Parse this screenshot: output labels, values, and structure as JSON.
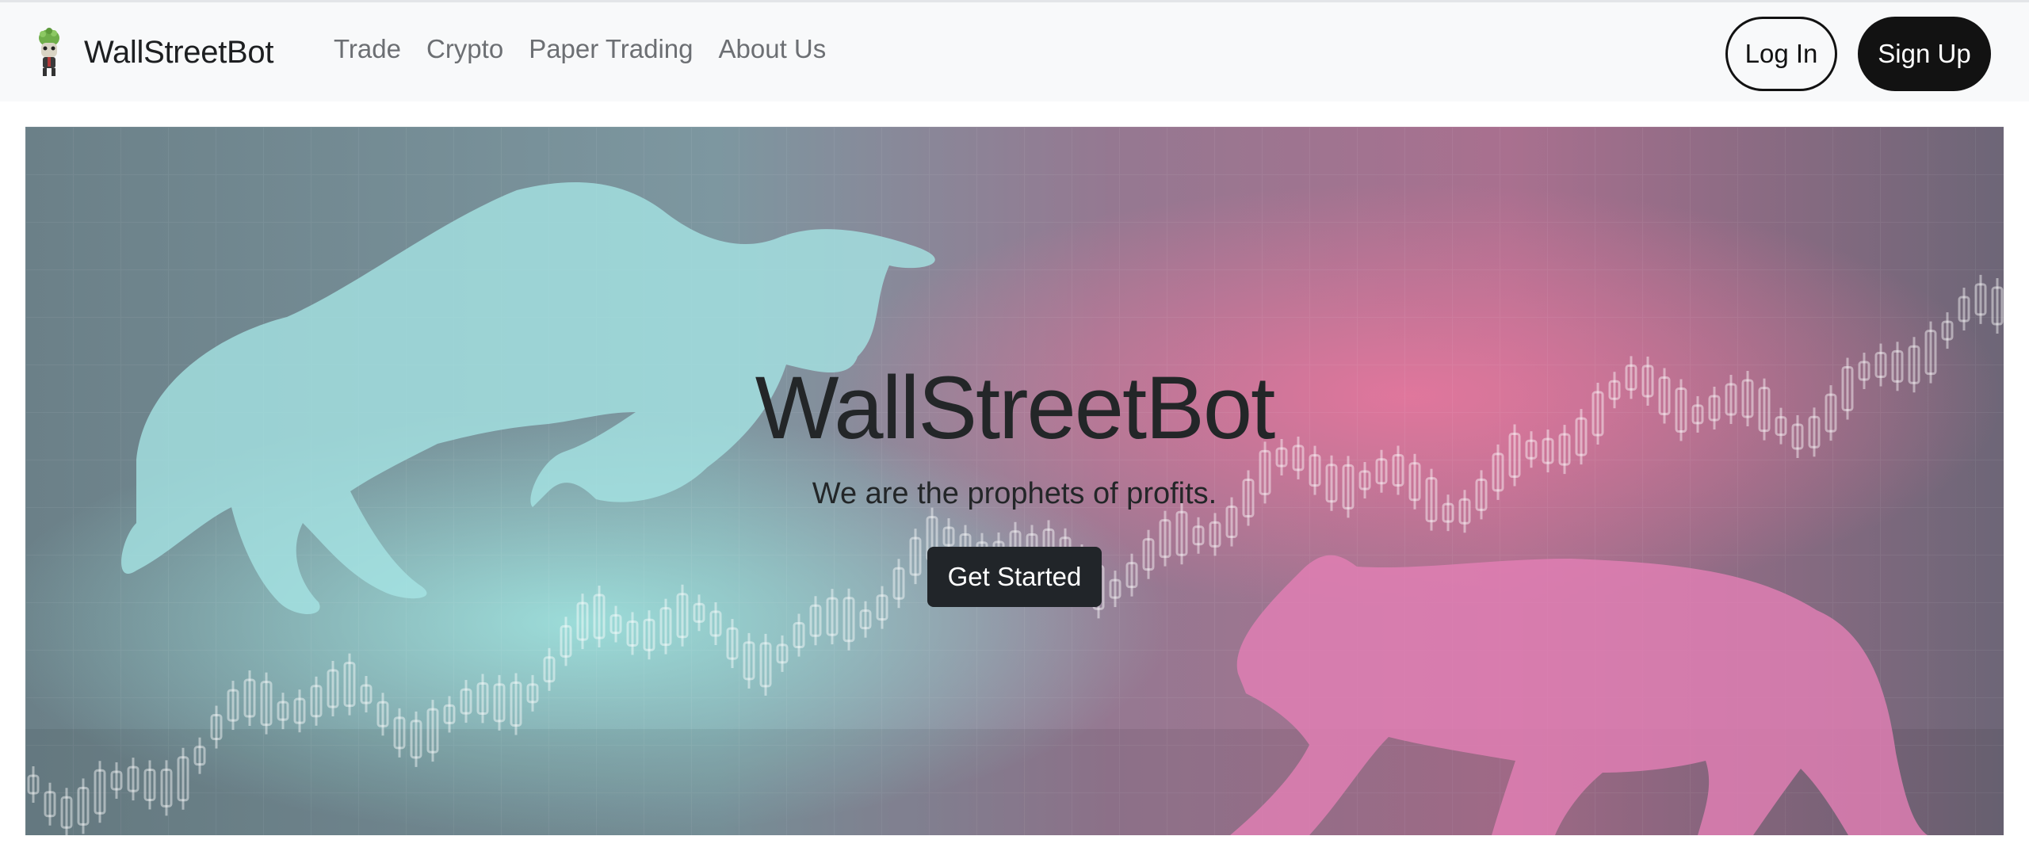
{
  "navbar": {
    "brand_name": "WallStreetBot",
    "links": [
      "Trade",
      "Crypto",
      "Paper Trading",
      "About Us"
    ],
    "login_label": "Log In",
    "signup_label": "Sign Up"
  },
  "hero": {
    "title": "WallStreetBot",
    "subtitle": "We are the prophets of profits.",
    "cta_label": "Get Started"
  },
  "colors": {
    "navbar_bg": "#f8f9fa",
    "button_dark": "#121212",
    "cta_bg": "#212529",
    "bull_color": "#9fe0e0",
    "bear_color": "#e07fb3"
  },
  "icons": {
    "brand_logo": "bull-mascot-icon"
  }
}
